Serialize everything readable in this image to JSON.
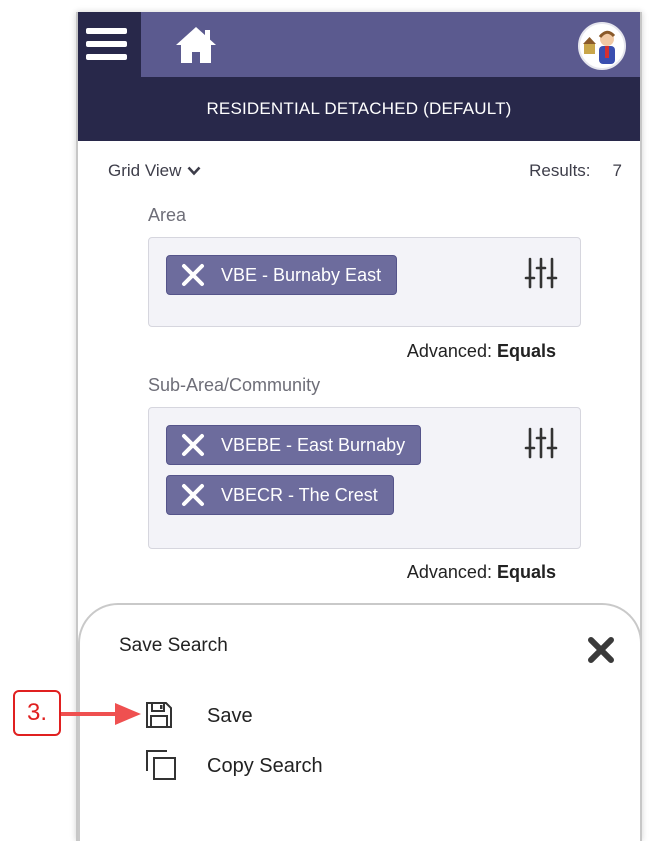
{
  "header": {
    "menu_icon": "hamburger-menu-icon",
    "home_icon": "home-icon",
    "avatar": "user-avatar",
    "subtitle": "RESIDENTIAL DETACHED (DEFAULT)"
  },
  "toolbar": {
    "view_label": "Grid View",
    "results_label": "Results:",
    "results_count": "7"
  },
  "filters": [
    {
      "label": "Area",
      "chips": [
        "VBE - Burnaby East"
      ],
      "advanced_label": "Advanced:",
      "advanced_value": "Equals"
    },
    {
      "label": "Sub-Area/Community",
      "chips": [
        "VBEBE - East Burnaby",
        "VBECR - The Crest"
      ],
      "advanced_label": "Advanced:",
      "advanced_value": "Equals"
    }
  ],
  "sheet": {
    "title": "Save Search",
    "items": [
      {
        "label": "Save",
        "icon": "floppy-disk-icon"
      },
      {
        "label": "Copy Search",
        "icon": "copy-icon"
      }
    ]
  },
  "annotation": {
    "step_label": "3."
  },
  "colors": {
    "top_bar": "#5b5a8f",
    "dark_bar": "#28284a",
    "chip": "#6d6c9d",
    "callout": "#e02020"
  }
}
